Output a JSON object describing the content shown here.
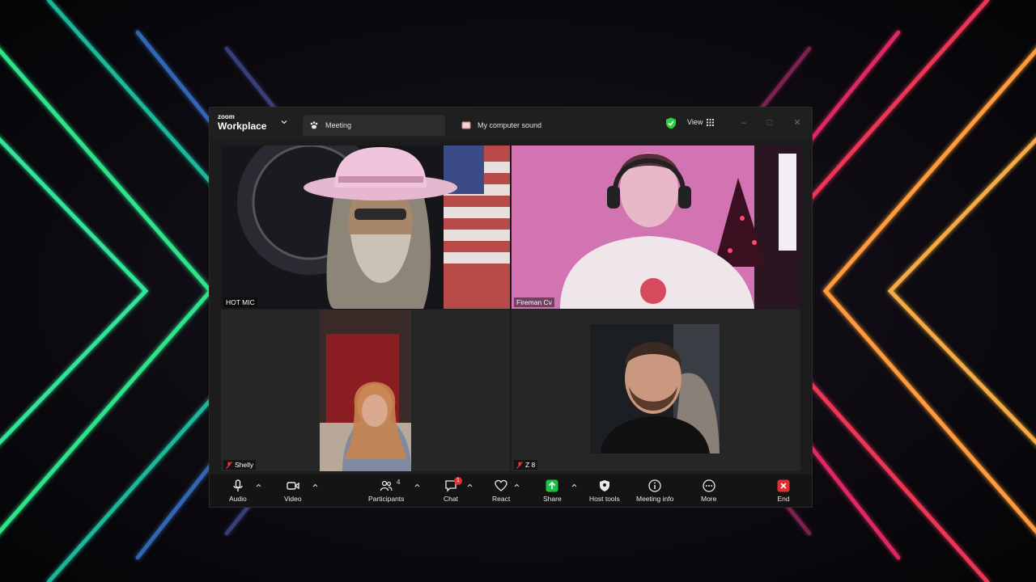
{
  "window": {
    "brand_small": "zoom",
    "brand": "Workplace",
    "tabs": [
      {
        "label": "Meeting",
        "active": true,
        "icon": "paw-icon"
      },
      {
        "label": "My computer sound",
        "active": false,
        "icon": "app-icon"
      }
    ],
    "view_label": "View",
    "security_icon": "shield-check-icon",
    "controls": [
      "minimize-icon",
      "maximize-icon",
      "close-icon"
    ]
  },
  "participants": [
    {
      "name": "HOT MIC",
      "muted": false,
      "active_speaker": true
    },
    {
      "name": "Fireman Cv",
      "muted": false,
      "active_speaker": false
    },
    {
      "name": "Shelly",
      "muted": true,
      "active_speaker": false
    },
    {
      "name": "Z 8",
      "muted": true,
      "active_speaker": false
    }
  ],
  "toolbar": {
    "audio": "Audio",
    "video": "Video",
    "participants": "Participants",
    "participants_count": "4",
    "chat": "Chat",
    "chat_badge": "1",
    "react": "React",
    "share": "Share",
    "host_tools": "Host tools",
    "meeting_info": "Meeting info",
    "more": "More",
    "end": "End"
  },
  "colors": {
    "active_speaker_border": "#3ddc84",
    "share_green": "#1fbf4a",
    "end_red": "#e02f2f",
    "badge_red": "#e02f2f",
    "security_green": "#2ecc40"
  }
}
